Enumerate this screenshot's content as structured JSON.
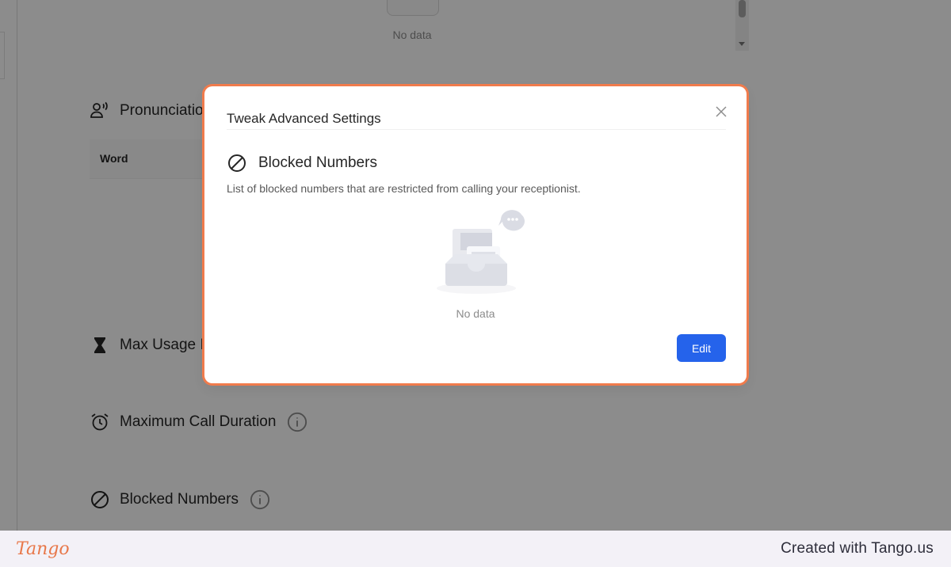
{
  "background": {
    "top_empty_text": "No data",
    "sections": [
      {
        "label": "Pronunciatio",
        "icon": "voice-person-icon"
      },
      {
        "label": "Max Usage I",
        "icon": "hourglass-icon"
      },
      {
        "label": "Maximum Call Duration",
        "icon": "alarm-clock-icon"
      },
      {
        "label": "Blocked Numbers",
        "icon": "block-icon"
      }
    ],
    "table_header": "Word"
  },
  "modal": {
    "title": "Tweak Advanced Settings",
    "section_title": "Blocked Numbers",
    "section_icon": "block-icon",
    "description": "List of blocked numbers that are restricted from calling your receptionist.",
    "empty_text": "No data",
    "edit_label": "Edit",
    "close_icon": "close-icon"
  },
  "footer": {
    "logo_text": "Tango",
    "credit": "Created with Tango.us"
  },
  "colors": {
    "highlight": "#f07b4c",
    "primary": "#2563eb"
  }
}
